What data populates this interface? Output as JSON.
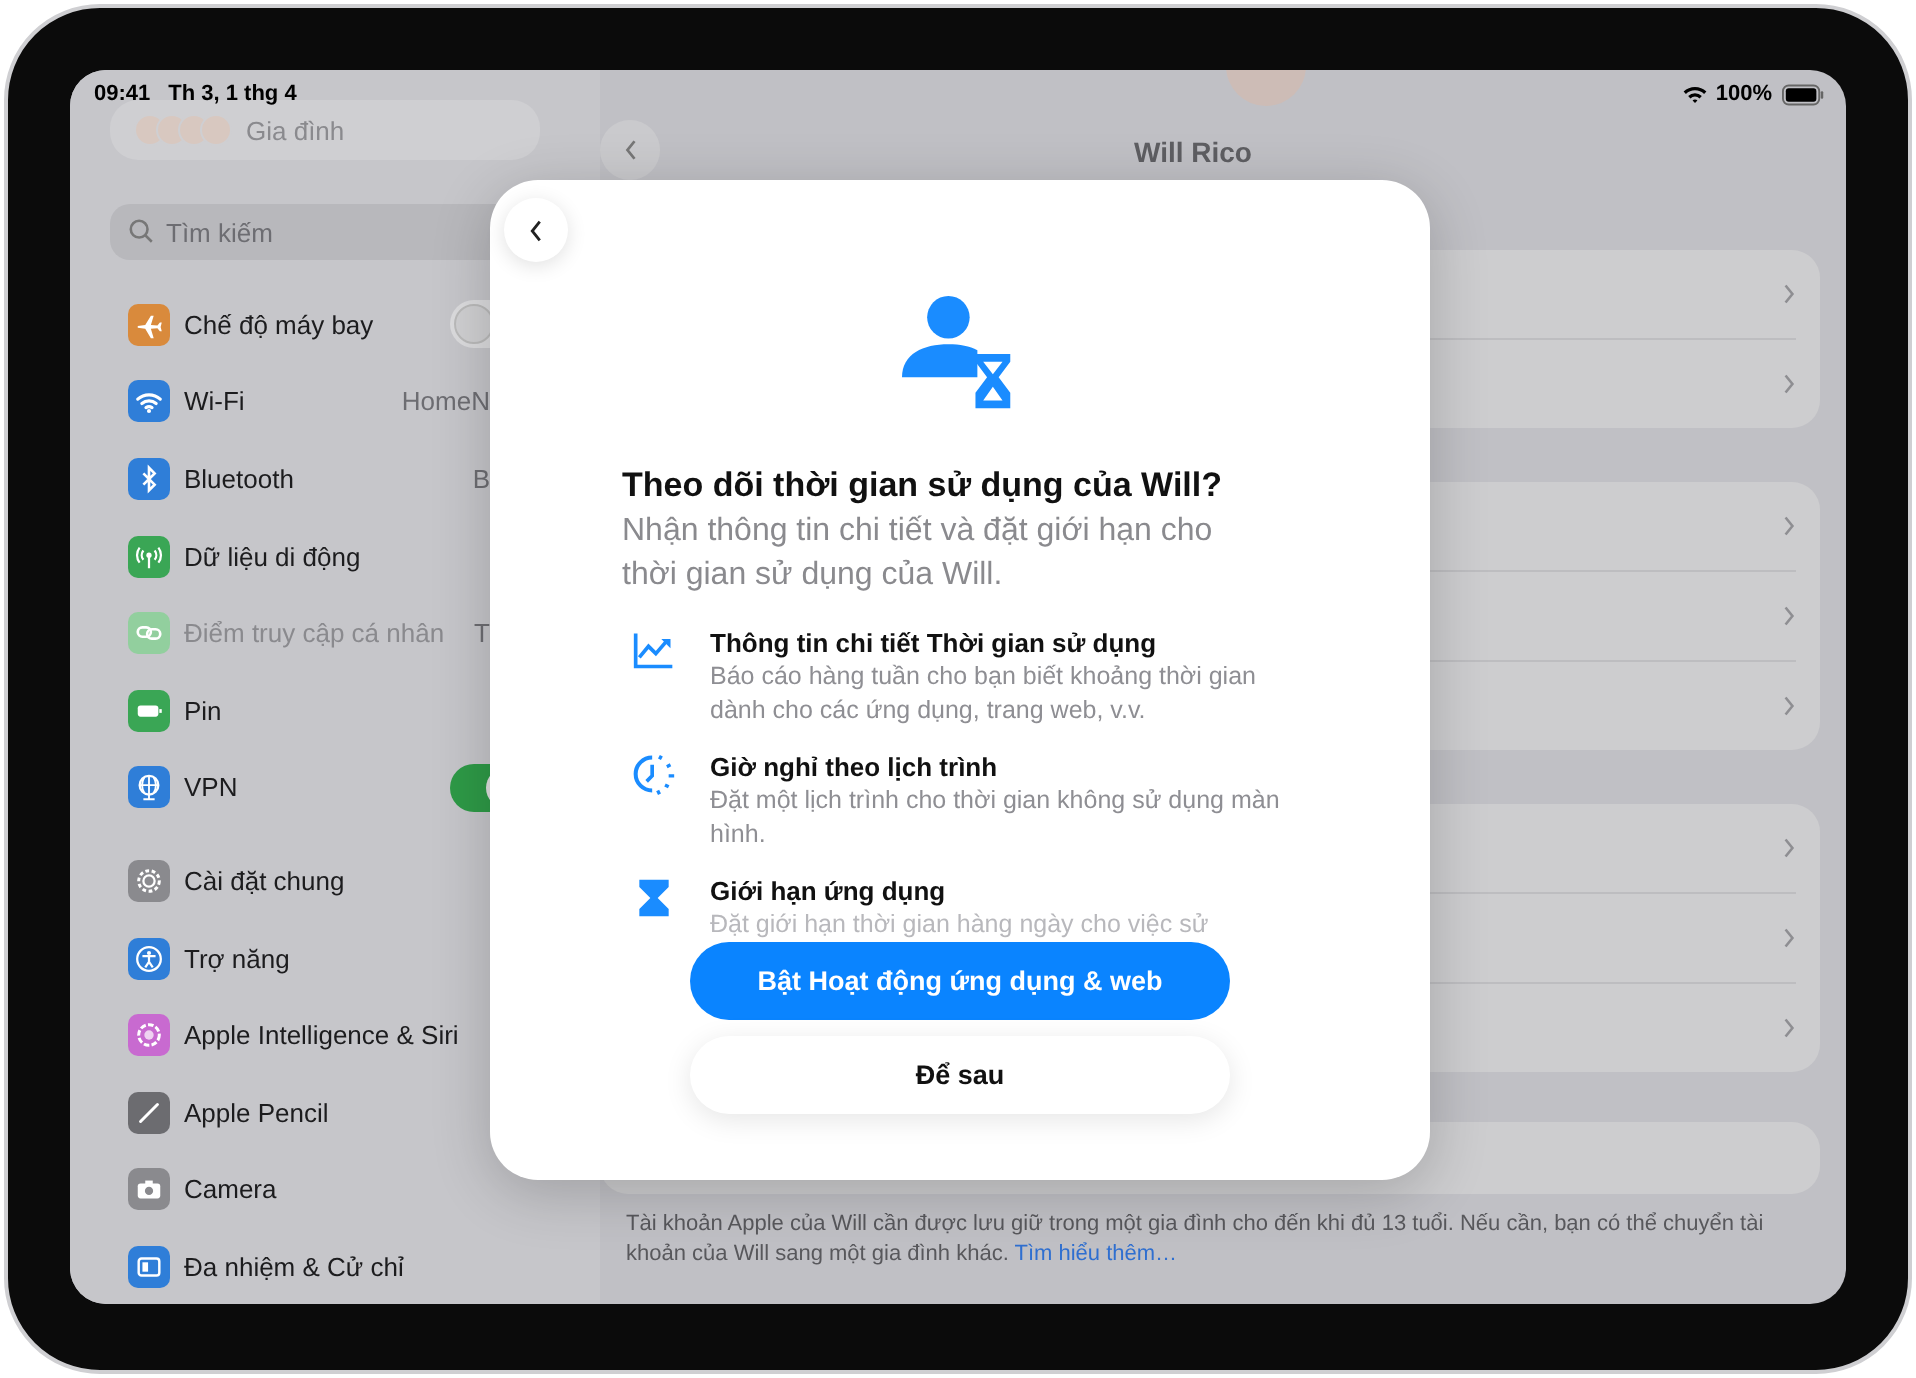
{
  "status_bar": {
    "time": "09:41",
    "date": "Th 3, 1 thg 4",
    "battery": "100%"
  },
  "sidebar": {
    "family": "Gia đình",
    "search": {
      "placeholder": "Tìm kiếm"
    },
    "groups": [
      {
        "items": [
          {
            "label": "Chế độ máy bay",
            "color": "#d98a3c",
            "kind": "toggle",
            "on": false,
            "disabled": false
          },
          {
            "label": "Wi-Fi",
            "color": "#2f7ed8",
            "kind": "link",
            "value": "HomeN",
            "disabled": false
          },
          {
            "label": "Bluetooth",
            "color": "#2f7ed8",
            "kind": "link",
            "value": "B",
            "disabled": false
          },
          {
            "label": "Dữ liệu di động",
            "color": "#3aa655",
            "kind": "link",
            "disabled": false
          },
          {
            "label": "Điểm truy cập cá nhân",
            "color": "#92cf9e",
            "kind": "link",
            "value": "T",
            "disabled": true
          },
          {
            "label": "Pin",
            "color": "#3aa655",
            "kind": "link",
            "disabled": false
          },
          {
            "label": "VPN",
            "color": "#2f7ed8",
            "kind": "toggle",
            "on": true,
            "disabled": false
          }
        ]
      },
      {
        "items": [
          {
            "label": "Cài đặt chung",
            "color": "#8a8a8e",
            "kind": "link",
            "disabled": false
          },
          {
            "label": "Trợ năng",
            "color": "#2f7ed8",
            "kind": "link",
            "disabled": false
          },
          {
            "label": "Apple Intelligence & Siri",
            "color": "#c86ad0",
            "kind": "link",
            "disabled": false
          },
          {
            "label": "Apple Pencil",
            "color": "#6c6c70",
            "kind": "link",
            "disabled": false
          },
          {
            "label": "Camera",
            "color": "#8a8a8e",
            "kind": "link",
            "disabled": false
          },
          {
            "label": "Đa nhiệm & Cử chỉ",
            "color": "#2f7ed8",
            "kind": "link",
            "disabled": false
          }
        ]
      }
    ]
  },
  "detail": {
    "name": "Will Rico",
    "note": "Tài khoản Apple của Will cần được lưu giữ trong một gia đình cho đến khi đủ 13 tuổi. Nếu cần, bạn có thể chuyển tài khoản của Will sang một gia đình khác.",
    "link": "Tìm hiểu thêm…"
  },
  "modal": {
    "title": "Theo dõi thời gian sử dụng của Will?",
    "subtitle": "Nhận thông tin chi tiết và đặt giới hạn cho thời gian sử dụng của Will.",
    "features": [
      {
        "title": "Thông tin chi tiết Thời gian sử dụng",
        "text": "Báo cáo hàng tuần cho bạn biết khoảng thời gian dành cho các ứng dụng, trang web, v.v."
      },
      {
        "title": "Giờ nghỉ theo lịch trình",
        "text": "Đặt một lịch trình cho thời gian không sử dụng màn hình."
      },
      {
        "title": "Giới hạn ứng dụng",
        "text": "Đặt giới hạn thời gian hàng ngày cho việc sử"
      }
    ],
    "primary": "Bật Hoạt động ứng dụng & web",
    "secondary": "Để sau"
  }
}
